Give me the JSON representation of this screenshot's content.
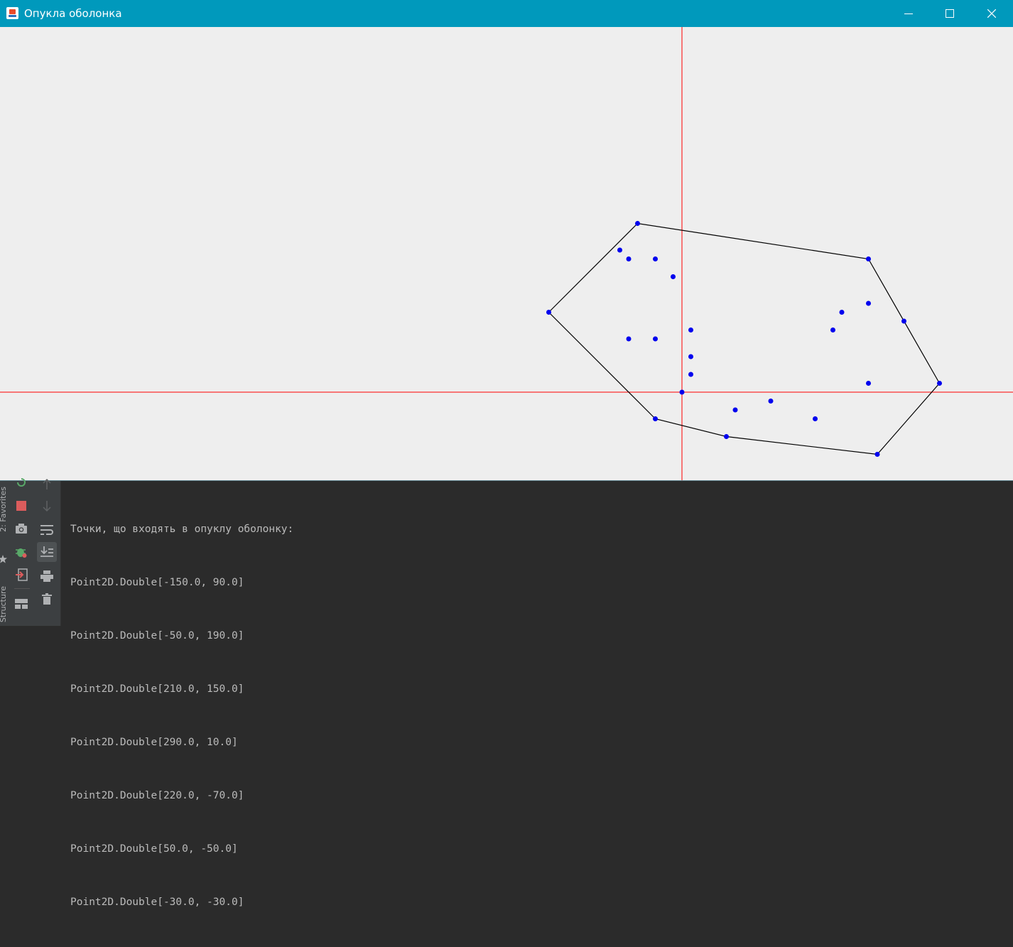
{
  "window": {
    "title": "Опукла оболонка",
    "titlebar_color": "#0099bc",
    "icons": [
      "java-app-icon",
      "minimize-icon",
      "maximize-icon",
      "close-icon"
    ]
  },
  "canvas": {
    "background": "#eeeeee",
    "axis_color": "#ff0000",
    "point_color": "#0000ee",
    "hull_color": "#000000",
    "points": [
      [
        -150,
        90
      ],
      [
        -70,
        160
      ],
      [
        -60,
        150
      ],
      [
        -30,
        150
      ],
      [
        -10,
        130
      ],
      [
        -60,
        60
      ],
      [
        -30,
        60
      ],
      [
        -50,
        190
      ],
      [
        10,
        70
      ],
      [
        10,
        40
      ],
      [
        10,
        20
      ],
      [
        0,
        0
      ],
      [
        -30,
        -30
      ],
      [
        50,
        -50
      ],
      [
        60,
        -20
      ],
      [
        100,
        -10
      ],
      [
        150,
        -30
      ],
      [
        210,
        150
      ],
      [
        180,
        90
      ],
      [
        210,
        100
      ],
      [
        170,
        70
      ],
      [
        250,
        80
      ],
      [
        210,
        10
      ],
      [
        290,
        10
      ],
      [
        220,
        -70
      ]
    ],
    "hull": [
      [
        -150,
        90
      ],
      [
        -50,
        190
      ],
      [
        210,
        150
      ],
      [
        290,
        10
      ],
      [
        220,
        -70
      ],
      [
        50,
        -50
      ],
      [
        -30,
        -30
      ]
    ]
  },
  "console": {
    "lines": [
      "Точки, що входять в опуклу оболонку:",
      "Point2D.Double[-150.0, 90.0]",
      "Point2D.Double[-50.0, 190.0]",
      "Point2D.Double[210.0, 150.0]",
      "Point2D.Double[290.0, 10.0]",
      "Point2D.Double[220.0, -70.0]",
      "Point2D.Double[50.0, -50.0]",
      "Point2D.Double[-30.0, -30.0]"
    ],
    "side_labels": {
      "favorites": "2: Favorites",
      "structure": "Structure"
    },
    "toolbar_icons": [
      "rerun-icon",
      "stop-icon",
      "camera-icon",
      "debug-icon",
      "exit-icon",
      "layout-icon",
      "up-arrow-icon",
      "down-arrow-icon",
      "soft-wrap-icon",
      "scroll-to-end-icon",
      "print-icon",
      "trash-icon"
    ]
  }
}
